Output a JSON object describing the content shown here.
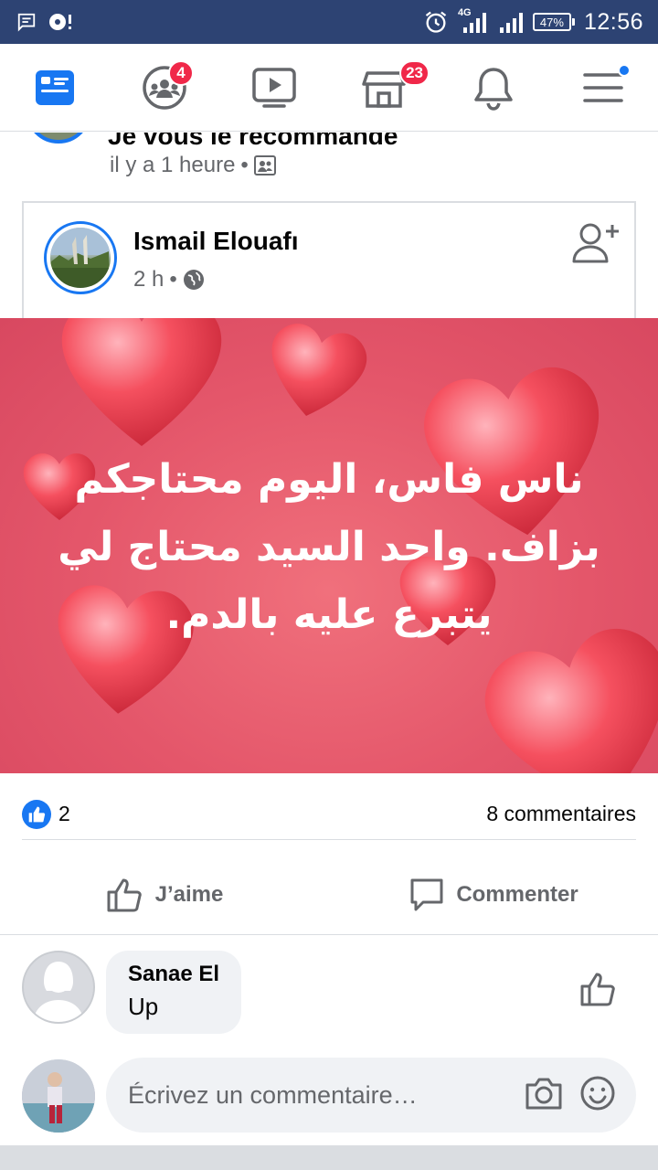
{
  "status_bar": {
    "network": "4G",
    "battery": "47%",
    "time": "12:56"
  },
  "nav": {
    "items": [
      {
        "name": "news-feed",
        "badge": null
      },
      {
        "name": "groups",
        "badge": "4"
      },
      {
        "name": "watch",
        "badge": null
      },
      {
        "name": "marketplace",
        "badge": "23"
      },
      {
        "name": "notifications",
        "badge": null
      },
      {
        "name": "menu",
        "badge": null
      }
    ],
    "accent": "#1877f2"
  },
  "previous_post": {
    "text": "Je vous le recommande",
    "time": "il y a 1 heure"
  },
  "post": {
    "author": "Ismail Elouafı",
    "time": "2 h",
    "audience_icon": "globe-icon",
    "image_text": "ناس فاس، اليوم محتاجكم بزاف. واحد السيد محتاج لي يتبرع عليه بالدم.",
    "likes": "2",
    "comments": "8 commentaires",
    "like_label": "J’aime",
    "comment_label": "Commenter"
  },
  "comment": {
    "author": "Sanae El",
    "text": "Up"
  },
  "composer": {
    "placeholder": "Écrivez un commentaire…"
  }
}
